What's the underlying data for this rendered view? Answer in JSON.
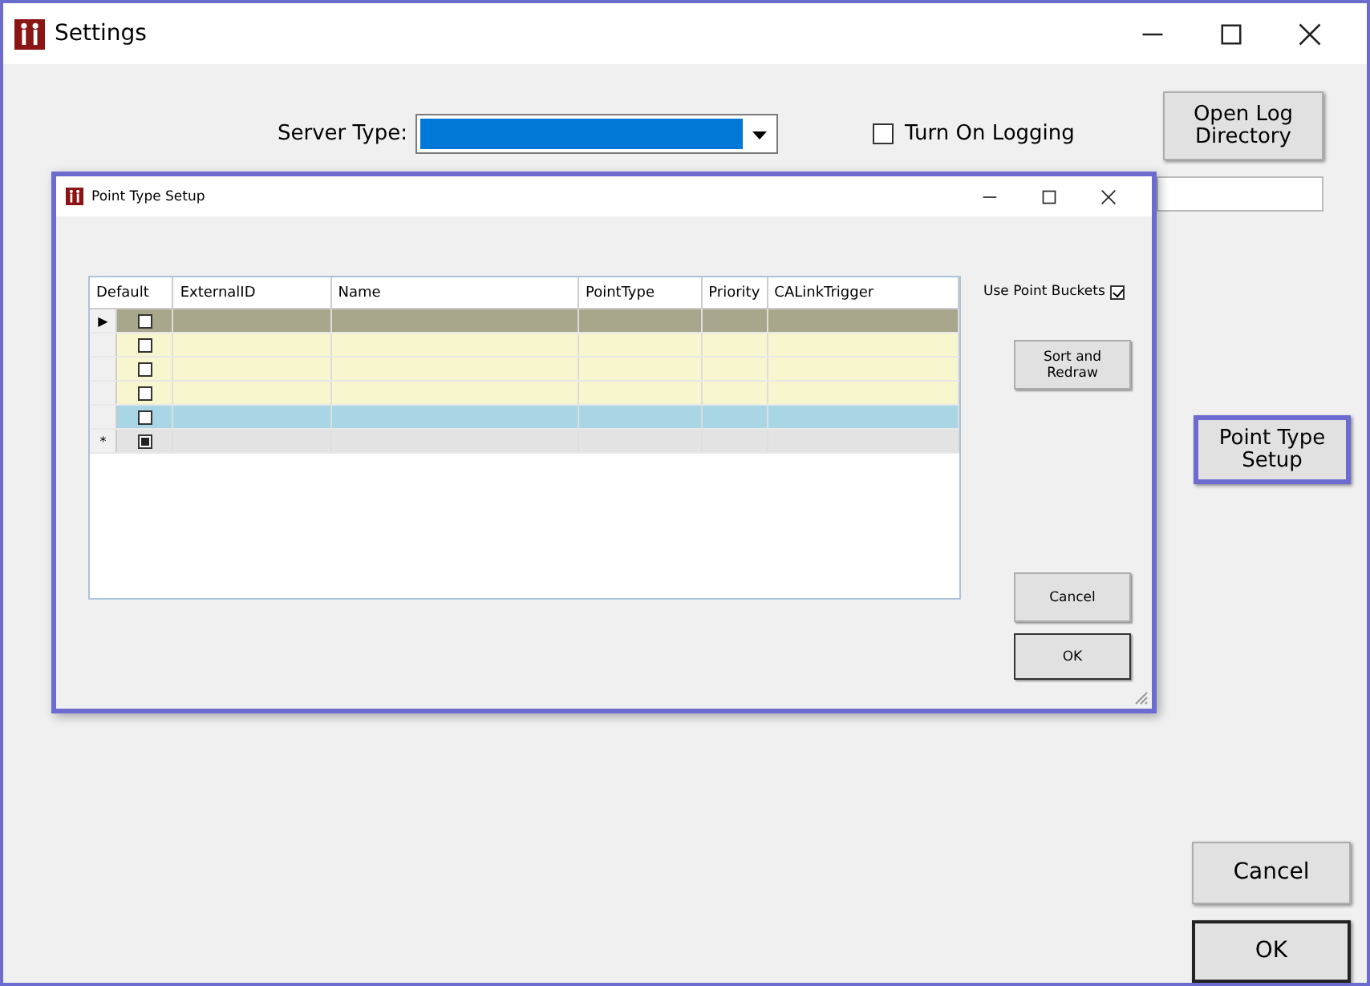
{
  "window": {
    "title": "Settings"
  },
  "server_type": {
    "label": "Server Type:"
  },
  "logging": {
    "label": "Turn On Logging",
    "checked": false
  },
  "open_log_button": {
    "label": "Open Log Directory"
  },
  "point_type_button": {
    "label": "Point Type Setup",
    "highlighted": true
  },
  "footer_buttons": [
    {
      "label": "Cancel",
      "default": false
    },
    {
      "label": "OK",
      "default": true
    }
  ],
  "dialog": {
    "title": "Point Type Setup",
    "columns": [
      "Default",
      "ExternalID",
      "Name",
      "PointType",
      "Priority",
      "CALinkTrigger"
    ],
    "rows": [
      {
        "kind": "current",
        "marker": "▶",
        "checked": false
      },
      {
        "kind": "data",
        "checked": false
      },
      {
        "kind": "data",
        "checked": false
      },
      {
        "kind": "data",
        "checked": false
      },
      {
        "kind": "selected",
        "checked": false
      },
      {
        "kind": "new",
        "marker": "*",
        "checked": true
      }
    ],
    "use_point_buckets": {
      "label": "Use Point Buckets",
      "checked": true
    },
    "sort_button": {
      "label": "Sort and Redraw"
    },
    "buttons": [
      {
        "label": "Cancel",
        "default": false
      },
      {
        "label": "OK",
        "default": true
      }
    ]
  }
}
